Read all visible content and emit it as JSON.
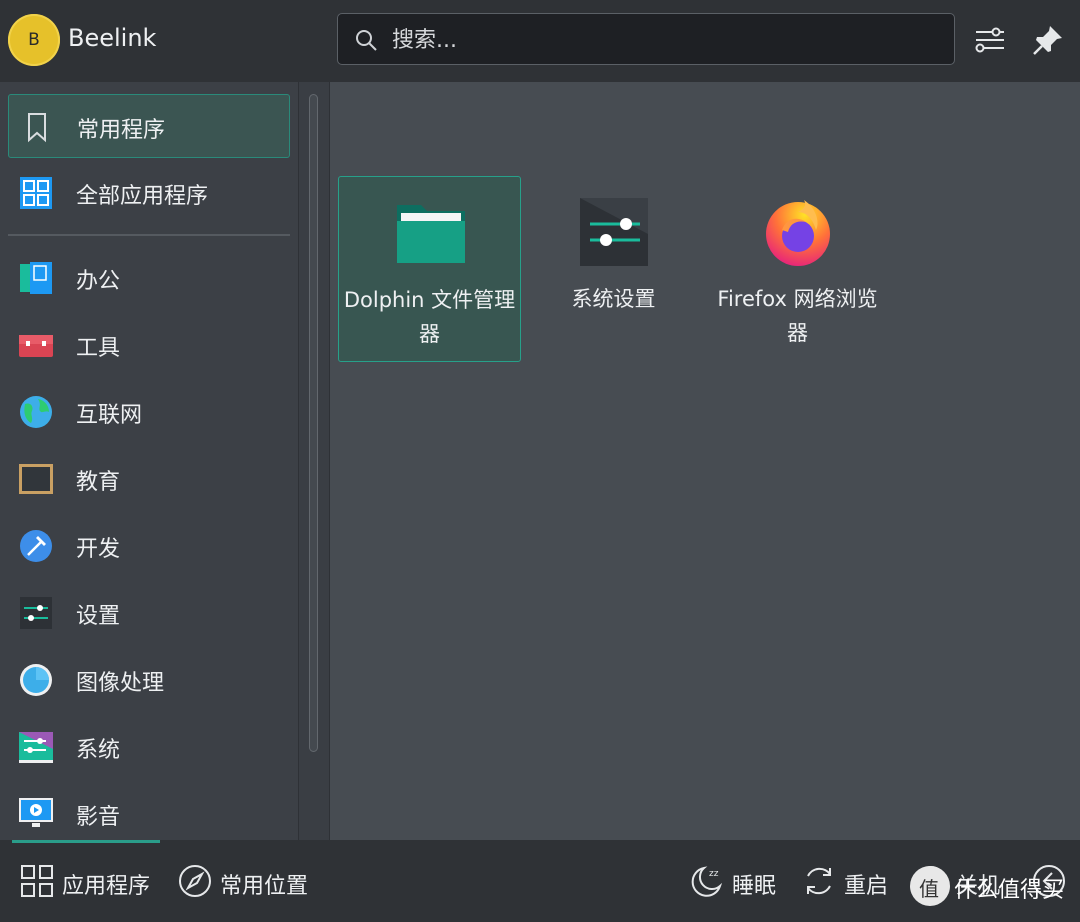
{
  "user": {
    "avatar_letter": "B",
    "name": "Beelink"
  },
  "search": {
    "placeholder": "搜索..."
  },
  "header": {
    "configure_icon": "sliders-icon",
    "pin_icon": "pin-icon"
  },
  "sidebar": {
    "items": [
      {
        "label": "常用程序",
        "icon": "bookmark-icon",
        "active": true
      },
      {
        "label": "全部应用程序",
        "icon": "grid-icon"
      },
      {
        "label": "办公",
        "icon": "office-icon"
      },
      {
        "label": "工具",
        "icon": "toolbox-icon"
      },
      {
        "label": "互联网",
        "icon": "globe-icon"
      },
      {
        "label": "教育",
        "icon": "chalkboard-icon"
      },
      {
        "label": "开发",
        "icon": "hammer-icon"
      },
      {
        "label": "设置",
        "icon": "settings-icon"
      },
      {
        "label": "图像处理",
        "icon": "graphics-icon"
      },
      {
        "label": "系统",
        "icon": "system-icon"
      },
      {
        "label": "影音",
        "icon": "multimedia-icon"
      }
    ]
  },
  "apps": [
    {
      "label": "Dolphin 文件管理器",
      "icon": "folder-icon",
      "active": true
    },
    {
      "label": "系统设置",
      "icon": "system-settings-icon"
    },
    {
      "label": "Firefox 网络浏览器",
      "icon": "firefox-icon"
    }
  ],
  "footer": {
    "tabs": [
      {
        "label": "应用程序",
        "icon": "apps-grid-icon",
        "active": true
      },
      {
        "label": "常用位置",
        "icon": "compass-icon"
      }
    ],
    "power": [
      {
        "label": "睡眠",
        "icon": "sleep-icon"
      },
      {
        "label": "重启",
        "icon": "restart-icon"
      },
      {
        "label": "关机",
        "icon": "shutdown-icon"
      }
    ]
  },
  "watermark": {
    "glyph": "值",
    "text": "什么值得买"
  },
  "colors": {
    "accent": "#2a9d8a",
    "header_bg": "#2f3236",
    "panel_bg": "#474c52"
  }
}
